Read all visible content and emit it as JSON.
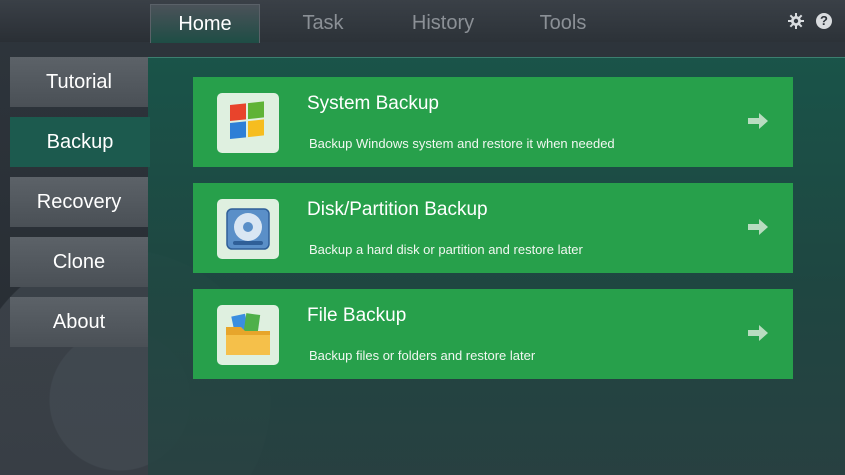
{
  "tabs": [
    {
      "label": "Home",
      "active": true
    },
    {
      "label": "Task",
      "active": false
    },
    {
      "label": "History",
      "active": false
    },
    {
      "label": "Tools",
      "active": false
    }
  ],
  "toolbar": {
    "settings_icon": "gear-icon",
    "help_icon": "help-icon",
    "help_glyph": "?"
  },
  "sidebar": {
    "items": [
      {
        "label": "Tutorial",
        "active": false
      },
      {
        "label": "Backup",
        "active": true
      },
      {
        "label": "Recovery",
        "active": false
      },
      {
        "label": "Clone",
        "active": false
      },
      {
        "label": "About",
        "active": false
      }
    ]
  },
  "cards": [
    {
      "title": "System Backup",
      "desc": "Backup Windows system and restore it when needed",
      "icon": "windows-logo-icon"
    },
    {
      "title": "Disk/Partition Backup",
      "desc": "Backup a hard disk or partition and restore later",
      "icon": "hard-disk-icon"
    },
    {
      "title": "File Backup",
      "desc": "Backup files or folders and restore later",
      "icon": "folder-icon"
    }
  ],
  "colors": {
    "card": "#27a04b",
    "panel": "#1c5a4e",
    "sidebar": "#52585e"
  }
}
